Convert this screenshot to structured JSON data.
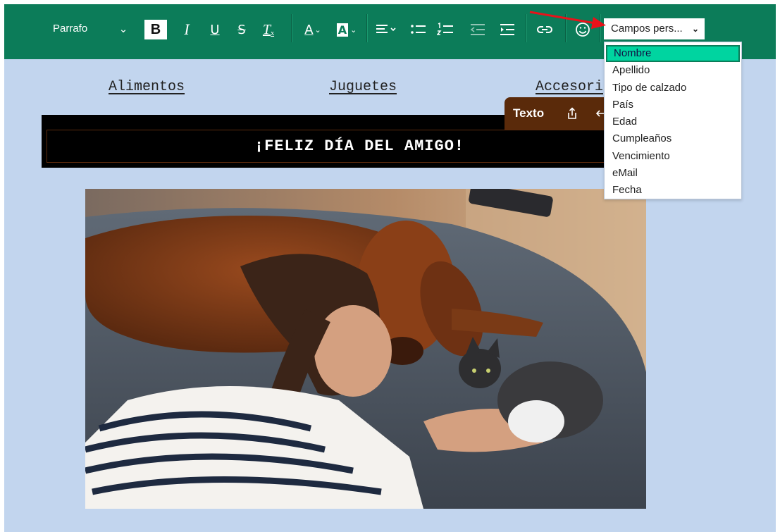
{
  "toolbar": {
    "format_label": "Parrafo",
    "bold": "B",
    "italic": "I",
    "underline": "U",
    "strikethrough": "S",
    "clear_format": "T",
    "font_color": "A",
    "bg_color": "A",
    "custom_fields_label": "Campos pers...",
    "accent_color": "#0c7c59"
  },
  "dropdown": {
    "items": [
      "Nombre",
      "Apellido",
      "Tipo de calzado",
      "País",
      "Edad",
      "Cumpleaños",
      "Vencimiento",
      "eMail",
      "Fecha"
    ],
    "selected_index": 0,
    "highlight_color": "#00d4a0"
  },
  "nav": {
    "links": [
      "Alimentos",
      "Juguetes",
      "Accesori"
    ]
  },
  "texto_panel": {
    "label": "Texto"
  },
  "banner": {
    "text": "¡FELIZ DÍA DEL AMIGO!"
  },
  "canvas": {
    "background": "#c2d5ee"
  }
}
